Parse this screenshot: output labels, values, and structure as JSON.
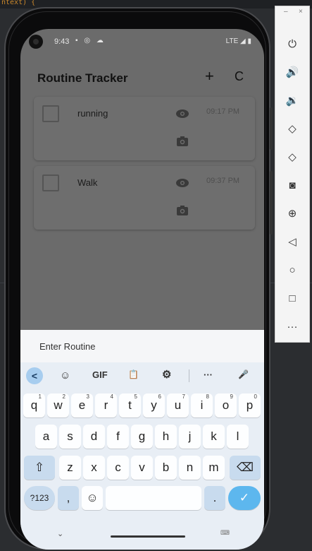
{
  "ide": {
    "code_fragment": "ntext) {"
  },
  "status_bar": {
    "time": "9:43",
    "icons": "▪ ◎ ☁",
    "network": "LTE ◢ ▮"
  },
  "app": {
    "title": "Routine Tracker",
    "add_label": "+",
    "refresh_label": "C"
  },
  "routines": [
    {
      "name": "running",
      "time": "09:17 PM",
      "checked": false
    },
    {
      "name": "Walk",
      "time": "09:37 PM",
      "checked": false
    }
  ],
  "input": {
    "placeholder": "Enter Routine"
  },
  "keyboard": {
    "toolbar": {
      "back": "<",
      "sticker": "☺",
      "gif": "GIF",
      "clipboard": "📋",
      "settings": "⚙",
      "more": "···",
      "mic": "🎤"
    },
    "row1": [
      {
        "k": "q",
        "n": "1"
      },
      {
        "k": "w",
        "n": "2"
      },
      {
        "k": "e",
        "n": "3"
      },
      {
        "k": "r",
        "n": "4"
      },
      {
        "k": "t",
        "n": "5"
      },
      {
        "k": "y",
        "n": "6"
      },
      {
        "k": "u",
        "n": "7"
      },
      {
        "k": "i",
        "n": "8"
      },
      {
        "k": "o",
        "n": "9"
      },
      {
        "k": "p",
        "n": "0"
      }
    ],
    "row2": [
      "a",
      "s",
      "d",
      "f",
      "g",
      "h",
      "j",
      "k",
      "l"
    ],
    "row3": [
      "z",
      "x",
      "c",
      "v",
      "b",
      "n",
      "m"
    ],
    "shift": "⇧",
    "backspace": "⌫",
    "symbols": "?123",
    "comma": ",",
    "emoji": "☺",
    "period": ".",
    "enter": "✓"
  },
  "nav": {
    "hide_keyboard": "⌄",
    "switch_keyboard": "⌨"
  },
  "emulator": {
    "minimize": "–",
    "close": "×",
    "buttons": [
      {
        "name": "power",
        "glyph": "⏻"
      },
      {
        "name": "volume-up",
        "glyph": "🔊"
      },
      {
        "name": "volume-down",
        "glyph": "🔉"
      },
      {
        "name": "rotate-left",
        "glyph": "◇"
      },
      {
        "name": "rotate-right",
        "glyph": "◇"
      },
      {
        "name": "screenshot",
        "glyph": "◙"
      },
      {
        "name": "zoom",
        "glyph": "⊕"
      },
      {
        "name": "back",
        "glyph": "◁"
      },
      {
        "name": "home",
        "glyph": "○"
      },
      {
        "name": "overview",
        "glyph": "□"
      },
      {
        "name": "more",
        "glyph": "···"
      }
    ]
  },
  "colors": {
    "scrim": "#6b6b6b",
    "keyboard_bg": "#e8eef5",
    "enter_key": "#5db7ee",
    "modifier_key": "#c8dbee"
  }
}
